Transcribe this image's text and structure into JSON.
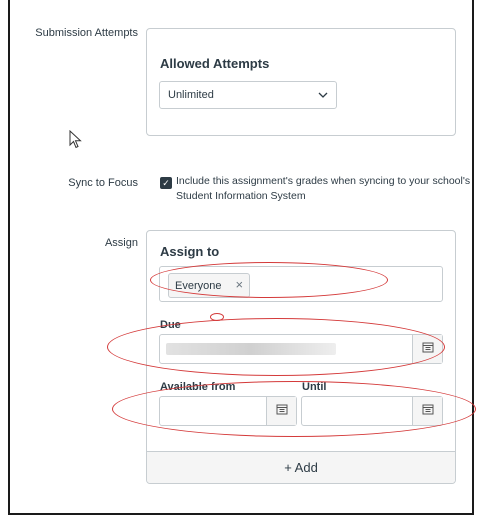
{
  "submission": {
    "row_label": "Submission Attempts",
    "card_title": "Allowed Attempts",
    "select_value": "Unlimited"
  },
  "sync": {
    "row_label": "Sync to Focus",
    "checkbox_checked": true,
    "text": "Include this assignment's grades when syncing to your school's Student Information System"
  },
  "assign": {
    "row_label": "Assign",
    "card_title": "Assign to",
    "chip_label": "Everyone",
    "chip_remove": "×",
    "due_label": "Due",
    "available_from_label": "Available from",
    "until_label": "Until",
    "add_label": "+ Add"
  },
  "colors": {
    "annotation": "#d43a3a",
    "border": "#c7cdd1",
    "text": "#2d3b45"
  },
  "icons": {
    "calendar": "calendar-icon",
    "chevron": "chevron-down-icon",
    "cursor": "mouse-pointer-icon"
  }
}
